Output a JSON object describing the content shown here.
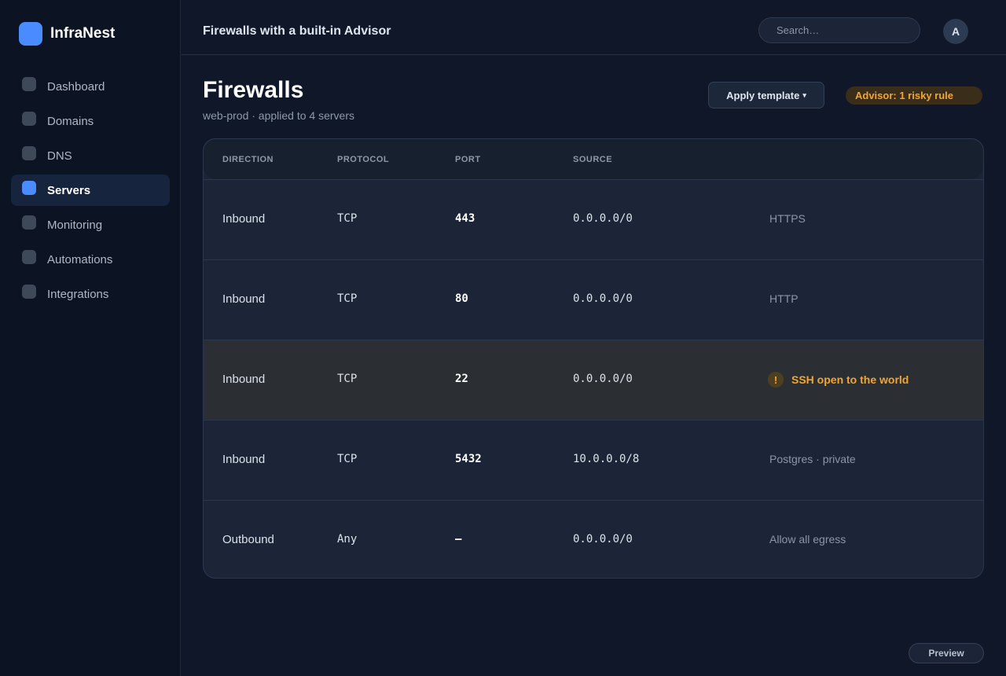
{
  "app": {
    "name": "InfraNest"
  },
  "sidebar": {
    "items": [
      {
        "label": "Dashboard",
        "active": false
      },
      {
        "label": "Domains",
        "active": false
      },
      {
        "label": "DNS",
        "active": false
      },
      {
        "label": "Servers",
        "active": true
      },
      {
        "label": "Monitoring",
        "active": false
      },
      {
        "label": "Automations",
        "active": false
      },
      {
        "label": "Integrations",
        "active": false
      }
    ]
  },
  "topbar": {
    "title": "Firewalls with a built-in Advisor",
    "search_placeholder": "Search…",
    "avatar_initial": "A"
  },
  "page": {
    "title": "Firewalls",
    "subtitle": "web-prod · applied to 4 servers",
    "apply_template_label": "Apply template",
    "apply_template_caret": "▾",
    "advisor_label": "Advisor: 1 risky rule"
  },
  "table": {
    "headers": [
      "DIRECTION",
      "PROTOCOL",
      "PORT",
      "SOURCE"
    ],
    "rows": [
      {
        "direction": "Inbound",
        "protocol": "TCP",
        "port": "443",
        "source": "0.0.0.0/0",
        "note": "HTTPS",
        "risky": false
      },
      {
        "direction": "Inbound",
        "protocol": "TCP",
        "port": "80",
        "source": "0.0.0.0/0",
        "note": "HTTP",
        "risky": false
      },
      {
        "direction": "Inbound",
        "protocol": "TCP",
        "port": "22",
        "source": "0.0.0.0/0",
        "note": "SSH open to the world",
        "risky": true,
        "warn_icon": "!"
      },
      {
        "direction": "Inbound",
        "protocol": "TCP",
        "port": "5432",
        "source": "10.0.0.0/8",
        "note": "Postgres · private",
        "risky": false
      },
      {
        "direction": "Outbound",
        "protocol": "Any",
        "port": "—",
        "source": "0.0.0.0/0",
        "note": "Allow all egress",
        "risky": false
      }
    ]
  },
  "footer": {
    "preview_label": "Preview"
  },
  "colors": {
    "accent": "#4a8cff",
    "warning": "#f2a531",
    "background": "#0f1729"
  },
  "icons": {
    "brand": "square-logo-icon",
    "nav": "square-nav-icon",
    "warning": "exclamation-circle-icon"
  }
}
